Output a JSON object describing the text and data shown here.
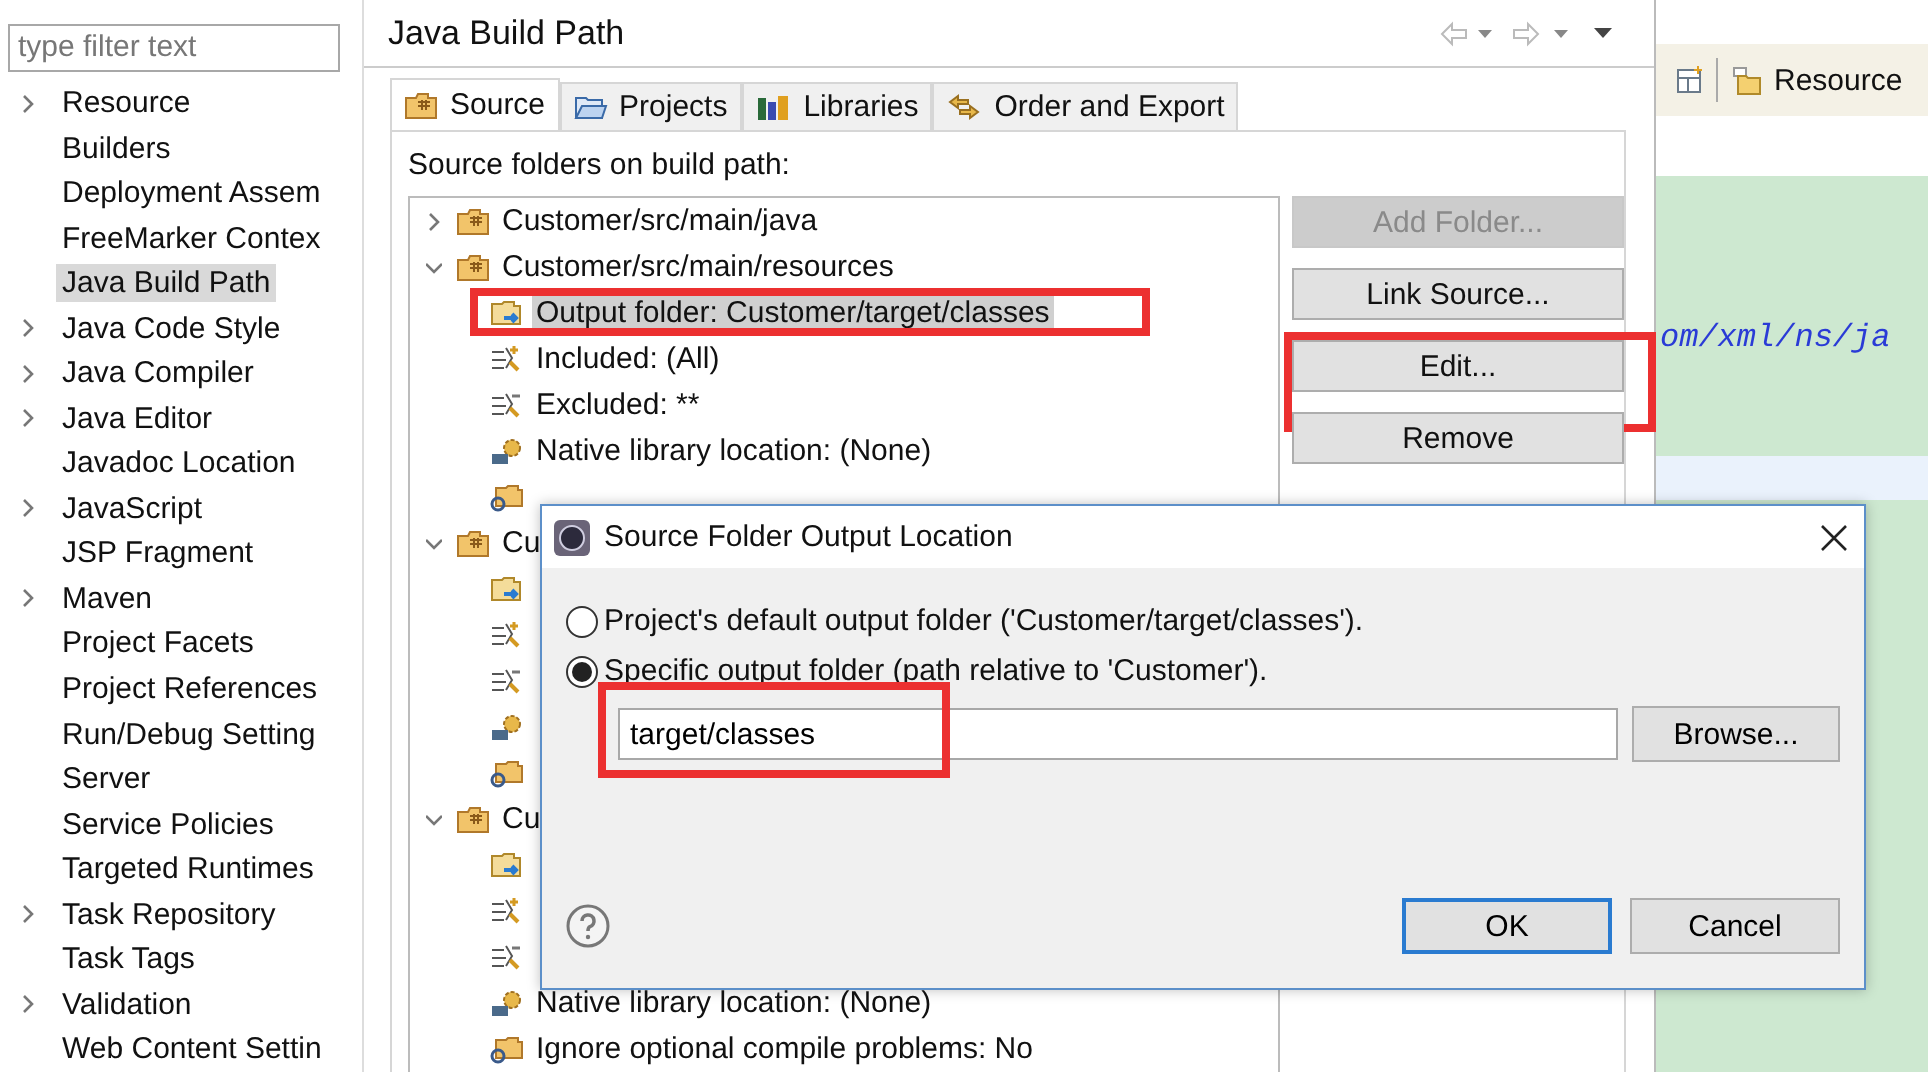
{
  "sidebar": {
    "filter": {
      "placeholder": "type filter text"
    },
    "items": [
      {
        "label": "Resource",
        "expandable": true,
        "selected": false
      },
      {
        "label": "Builders",
        "expandable": false,
        "selected": false
      },
      {
        "label": "Deployment Assem",
        "expandable": false,
        "selected": false
      },
      {
        "label": "FreeMarker Contex",
        "expandable": false,
        "selected": false
      },
      {
        "label": "Java Build Path",
        "expandable": false,
        "selected": true
      },
      {
        "label": "Java Code Style",
        "expandable": true,
        "selected": false
      },
      {
        "label": "Java Compiler",
        "expandable": true,
        "selected": false
      },
      {
        "label": "Java Editor",
        "expandable": true,
        "selected": false
      },
      {
        "label": "Javadoc Location",
        "expandable": false,
        "selected": false
      },
      {
        "label": "JavaScript",
        "expandable": true,
        "selected": false
      },
      {
        "label": "JSP Fragment",
        "expandable": false,
        "selected": false
      },
      {
        "label": "Maven",
        "expandable": true,
        "selected": false
      },
      {
        "label": "Project Facets",
        "expandable": false,
        "selected": false
      },
      {
        "label": "Project References",
        "expandable": false,
        "selected": false
      },
      {
        "label": "Run/Debug Setting",
        "expandable": false,
        "selected": false
      },
      {
        "label": "Server",
        "expandable": false,
        "selected": false
      },
      {
        "label": "Service Policies",
        "expandable": false,
        "selected": false
      },
      {
        "label": "Targeted Runtimes",
        "expandable": false,
        "selected": false
      },
      {
        "label": "Task Repository",
        "expandable": true,
        "selected": false
      },
      {
        "label": "Task Tags",
        "expandable": false,
        "selected": false
      },
      {
        "label": "Validation",
        "expandable": true,
        "selected": false
      },
      {
        "label": "Web Content Settin",
        "expandable": false,
        "selected": false
      }
    ]
  },
  "page": {
    "title": "Java Build Path",
    "tabs": [
      {
        "label": "Source",
        "kind": "source",
        "selected": true
      },
      {
        "label": "Projects",
        "kind": "projects",
        "selected": false
      },
      {
        "label": "Libraries",
        "kind": "libraries",
        "selected": false
      },
      {
        "label": "Order and Export",
        "kind": "order",
        "selected": false
      }
    ],
    "tree_label": "Source folders on build path:",
    "tree": [
      {
        "label": "Customer/src/main/java",
        "expanded": false,
        "selected": false
      },
      {
        "label": "Customer/src/main/resources",
        "expanded": true,
        "selected": false,
        "children": [
          {
            "kind": "output",
            "label": "Output folder: Customer/target/classes",
            "selected": true,
            "highlight": true
          },
          {
            "kind": "included",
            "label": "Included: (All)",
            "selected": false,
            "highlight": false
          },
          {
            "kind": "excluded",
            "label": "Excluded: **",
            "selected": false,
            "highlight": false
          },
          {
            "kind": "native",
            "label": "Native library location: (None)",
            "selected": false,
            "highlight": false
          },
          {
            "kind": "ignore"
          }
        ]
      },
      {
        "label": "Cu",
        "expanded": true,
        "selected": false,
        "children": [
          {
            "kind": "output"
          },
          {
            "kind": "included"
          },
          {
            "kind": "excluded"
          },
          {
            "kind": "native"
          },
          {
            "kind": "ignore"
          }
        ]
      },
      {
        "label": "Cu",
        "expanded": true,
        "selected": false,
        "children": [
          {
            "kind": "output"
          },
          {
            "kind": "included"
          },
          {
            "kind": "excluded"
          },
          {
            "kind": "native",
            "label": "Native library location: (None)",
            "selected": false,
            "highlight": false
          },
          {
            "kind": "ignore",
            "label": "Ignore optional compile problems: No",
            "selected": false,
            "highlight": false
          }
        ]
      }
    ],
    "buttons": [
      {
        "label": "Add Folder...",
        "disabled": true,
        "highlight": false
      },
      {
        "label": "Link Source...",
        "disabled": false,
        "highlight": false
      },
      {
        "label": "Edit...",
        "disabled": false,
        "highlight": true
      },
      {
        "label": "Remove",
        "disabled": false,
        "highlight": false
      }
    ]
  },
  "editor": {
    "toolbar_label": "Resource",
    "code_text": "om/xml/ns/ja"
  },
  "dialog": {
    "title": "Source Folder Output Location",
    "options": [
      {
        "label": "Project's default output folder ('Customer/target/classes').",
        "selected": false
      },
      {
        "label": "Specific output folder (path relative to 'Customer').",
        "selected": true
      }
    ],
    "path_field": {
      "value": "target/classes",
      "highlight": true
    },
    "browse_button": "Browse...",
    "buttons": [
      {
        "label": "OK",
        "default": true
      },
      {
        "label": "Cancel",
        "default": false
      }
    ]
  }
}
